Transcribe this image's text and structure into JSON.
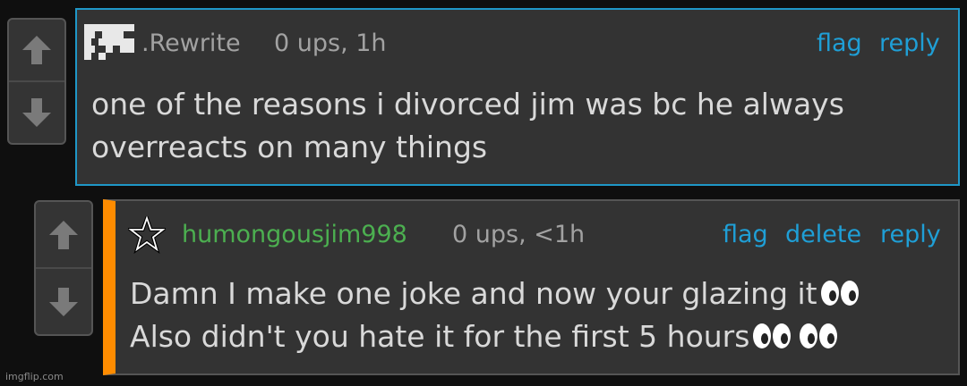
{
  "comments": [
    {
      "username": ".Rewrite",
      "meta": "0 ups, 1h",
      "actions": {
        "flag": "flag",
        "reply": "reply"
      },
      "lines": [
        "one of the reasons i divorced jim was bc he always",
        "overreacts on many things"
      ]
    },
    {
      "username": "humongousjim998",
      "meta": "0 ups, <1h",
      "actions": {
        "flag": "flag",
        "delete": "delete",
        "reply": "reply"
      },
      "lines": [
        "Damn I make one joke and now your glazing it",
        "Also didn't you hate it for the first 5 hours"
      ]
    }
  ],
  "icons": {
    "upvote": "up-arrow-icon",
    "downvote": "down-arrow-icon",
    "user1_avatar": "pixel-avatar-icon",
    "user2_avatar": "star-icon",
    "eyes": "eyes-emoji-icon"
  },
  "colors": {
    "accent_blue": "#1f9fd6",
    "reply_bar": "#ff8c00",
    "username2": "#4caf50",
    "username1": "#a2a2a2"
  },
  "watermark": "imgflip.com"
}
